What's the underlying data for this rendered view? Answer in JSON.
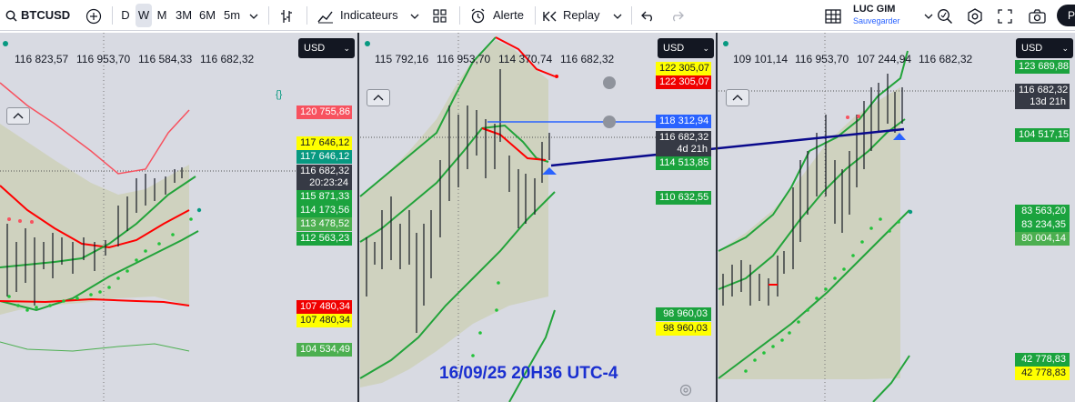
{
  "toolbar": {
    "symbol": "BTCUSD",
    "intervals": [
      "D",
      "W",
      "M",
      "3M",
      "6M",
      "5m"
    ],
    "active_interval": "W",
    "indicators_label": "Indicateurs",
    "alert_label": "Alerte",
    "replay_label": "Replay",
    "account_name": "LUC GIM",
    "account_status": "Sauvegarder",
    "publish_label": "Pu"
  },
  "panels": [
    {
      "ohlc": [
        "116 823,57",
        "116 953,70",
        "116 584,33",
        "116 682,32"
      ],
      "currency": "USD",
      "price_tags": [
        {
          "label": "120 755,86",
          "bg": "#f7525f",
          "fg": "#ffffff"
        },
        {
          "label": "117 646,12",
          "bg": "#ffff00",
          "fg": "#131722"
        },
        {
          "label": "117 646,12",
          "bg": "#089981",
          "fg": "#ffffff"
        },
        {
          "label": "116 682,32",
          "bg": "#363a45",
          "fg": "#ffffff"
        },
        {
          "label": "20:23:24",
          "bg": "#363a45",
          "fg": "#ffffff"
        },
        {
          "label": "115 871,33",
          "bg": "#1ba33e",
          "fg": "#ffffff"
        },
        {
          "label": "114 173,56",
          "bg": "#1ba33e",
          "fg": "#ffffff"
        },
        {
          "label": "113 478,52",
          "bg": "#4caf50",
          "fg": "#ffffff"
        },
        {
          "label": "112 563,23",
          "bg": "#1ba33e",
          "fg": "#ffffff"
        },
        {
          "label": "107 480,34",
          "bg": "#f00000",
          "fg": "#ffffff"
        },
        {
          "label": "107 480,34",
          "bg": "#ffff00",
          "fg": "#131722"
        },
        {
          "label": "104 534,49",
          "bg": "#4caf50",
          "fg": "#ffffff"
        }
      ]
    },
    {
      "ohlc": [
        "115 792,16",
        "116 953,70",
        "114 370,74",
        "116 682,32"
      ],
      "currency": "USD",
      "price_tags": [
        {
          "label": "122 305,07",
          "bg": "#ffff00",
          "fg": "#131722"
        },
        {
          "label": "122 305,07",
          "bg": "#f00000",
          "fg": "#ffffff"
        },
        {
          "label": "118 312,94",
          "bg": "#2962ff",
          "fg": "#ffffff"
        },
        {
          "label": "116 682,32",
          "bg": "#363a45",
          "fg": "#ffffff"
        },
        {
          "label": "4d 21h",
          "bg": "#363a45",
          "fg": "#ffffff"
        },
        {
          "label": "114 513,85",
          "bg": "#1ba33e",
          "fg": "#ffffff"
        },
        {
          "label": "110 632,55",
          "bg": "#1ba33e",
          "fg": "#ffffff"
        },
        {
          "label": "98 960,03",
          "bg": "#1ba33e",
          "fg": "#ffffff"
        },
        {
          "label": "98 960,03",
          "bg": "#ffff00",
          "fg": "#131722"
        }
      ],
      "annotation": "16/09/25 20H36 UTC-4"
    },
    {
      "ohlc": [
        "109 101,14",
        "116 953,70",
        "107 244,94",
        "116 682,32"
      ],
      "currency": "USD",
      "price_tags": [
        {
          "label": "123 689,88",
          "bg": "#1ba33e",
          "fg": "#ffffff"
        },
        {
          "label": "116 682,32",
          "bg": "#363a45",
          "fg": "#ffffff"
        },
        {
          "label": "13d 21h",
          "bg": "#363a45",
          "fg": "#ffffff"
        },
        {
          "label": "104 517,15",
          "bg": "#1ba33e",
          "fg": "#ffffff"
        },
        {
          "label": "83 563,20",
          "bg": "#1ba33e",
          "fg": "#ffffff"
        },
        {
          "label": "83 234,35",
          "bg": "#1ba33e",
          "fg": "#ffffff"
        },
        {
          "label": "80 004,14",
          "bg": "#4caf50",
          "fg": "#ffffff"
        },
        {
          "label": "42 778,83",
          "bg": "#1ba33e",
          "fg": "#ffffff"
        },
        {
          "label": "42 778,83",
          "bg": "#ffff00",
          "fg": "#131722"
        }
      ]
    }
  ]
}
